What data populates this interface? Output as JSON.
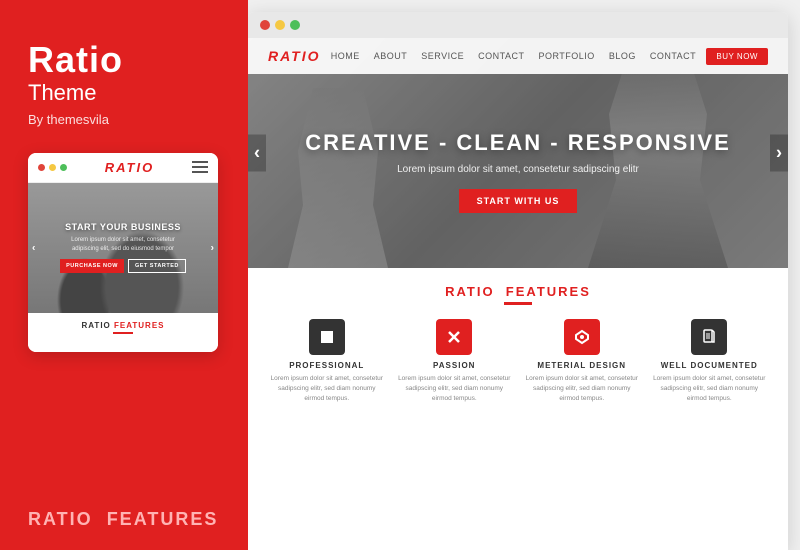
{
  "left": {
    "brand_title": "Ratio",
    "brand_subtitle": "Theme",
    "brand_by": "By themesvila",
    "mobile": {
      "logo": "RATIO",
      "hero_title": "START YOUR BUSINESS",
      "hero_sub": "Lorem ipsum dolor sit amet, consectetur\nadipiscing elit, sed do eiusmod tempor",
      "btn_primary": "PURCHASE NOW",
      "btn_outline": "GET STARTED",
      "nav_left": "‹",
      "nav_right": "›"
    },
    "bottom_features_prefix": "RATIO",
    "bottom_features_suffix": "FEATURES"
  },
  "right": {
    "browser": {
      "dots": [
        "red",
        "yellow",
        "green"
      ]
    },
    "website": {
      "nav": {
        "logo": "RATIO",
        "links": [
          "HOME",
          "ABOUT",
          "SERVICE",
          "CONTACT",
          "PORTFOLIO",
          "BLOG",
          "CONTACT"
        ],
        "cta": "BUY NOW"
      },
      "hero": {
        "title": "CREATIVE - CLEAN - RESPONSIVE",
        "subtitle": "Lorem ipsum dolor sit amet, consetetur sadipscing elitr",
        "cta": "START WITH US",
        "nav_left": "‹",
        "nav_right": "›"
      },
      "features": {
        "header_prefix": "RATIO",
        "header_suffix": "FEATURES",
        "items": [
          {
            "icon": "■",
            "icon_style": "dark",
            "name": "PROFESSIONAL",
            "desc": "Lorem ipsum dolor sit amet, consetetur sadipscing elitr, sed diam nonumy eirmod tempus."
          },
          {
            "icon": "✕",
            "icon_style": "red",
            "name": "PASSION",
            "desc": "Lorem ipsum dolor sit amet, consetetur sadipscing elitr, sed diam nonumy eirmod tempus."
          },
          {
            "icon": "◈",
            "icon_style": "blue",
            "name": "METERIAL DESIGN",
            "desc": "Lorem ipsum dolor sit amet, consetetur sadipscing elitr, sed diam nonumy eirmod tempus."
          },
          {
            "icon": "📄",
            "icon_style": "doc",
            "name": "WELL DOCUMENTED",
            "desc": "Lorem ipsum dolor sit amet, consetetur sadipscing elitr, sed diam nonumy eirmod tempus."
          }
        ]
      }
    }
  }
}
